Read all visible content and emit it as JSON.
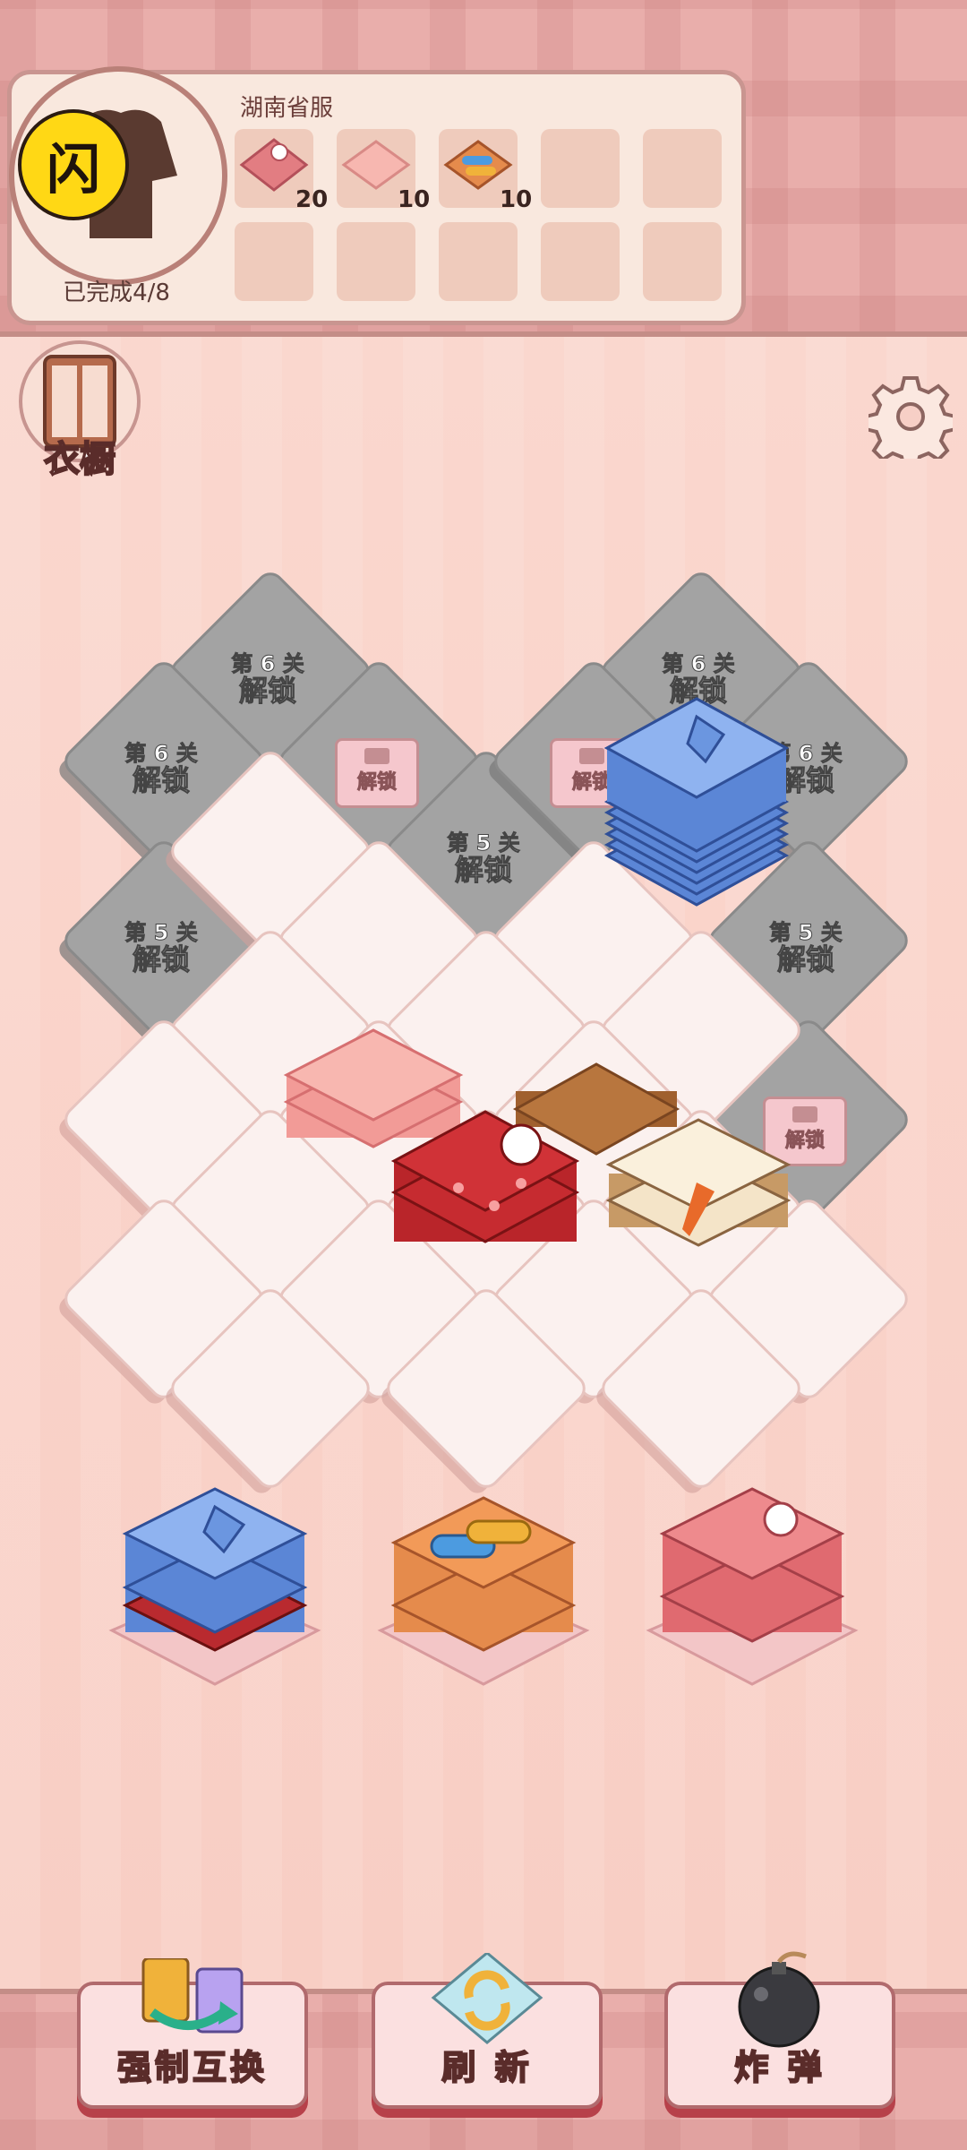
{
  "header": {
    "costume_title": "湖南省服",
    "progress_text": "已完成4/8",
    "badge_glyph": "闪",
    "slots": [
      {
        "icon": "red-floral-shirt-icon",
        "count": "20"
      },
      {
        "icon": "pink-cloth-icon",
        "count": "10"
      },
      {
        "icon": "thread-spools-icon",
        "count": "10"
      },
      {
        "icon": "",
        "count": ""
      },
      {
        "icon": "",
        "count": ""
      },
      {
        "icon": "",
        "count": ""
      },
      {
        "icon": "",
        "count": ""
      },
      {
        "icon": "",
        "count": ""
      },
      {
        "icon": "",
        "count": ""
      },
      {
        "icon": "",
        "count": ""
      }
    ]
  },
  "wardrobe_label": "衣橱",
  "locks": {
    "lv6": "第 6 关",
    "lv5": "第 5 关",
    "unlock": "解锁"
  },
  "buttons": {
    "swap": "强制互换",
    "refresh": "刷 新",
    "bomb": "炸 弹"
  },
  "colors": {
    "accent": "#e9aeab",
    "button_shadow": "#b7414a",
    "badge": "#ffd815"
  }
}
